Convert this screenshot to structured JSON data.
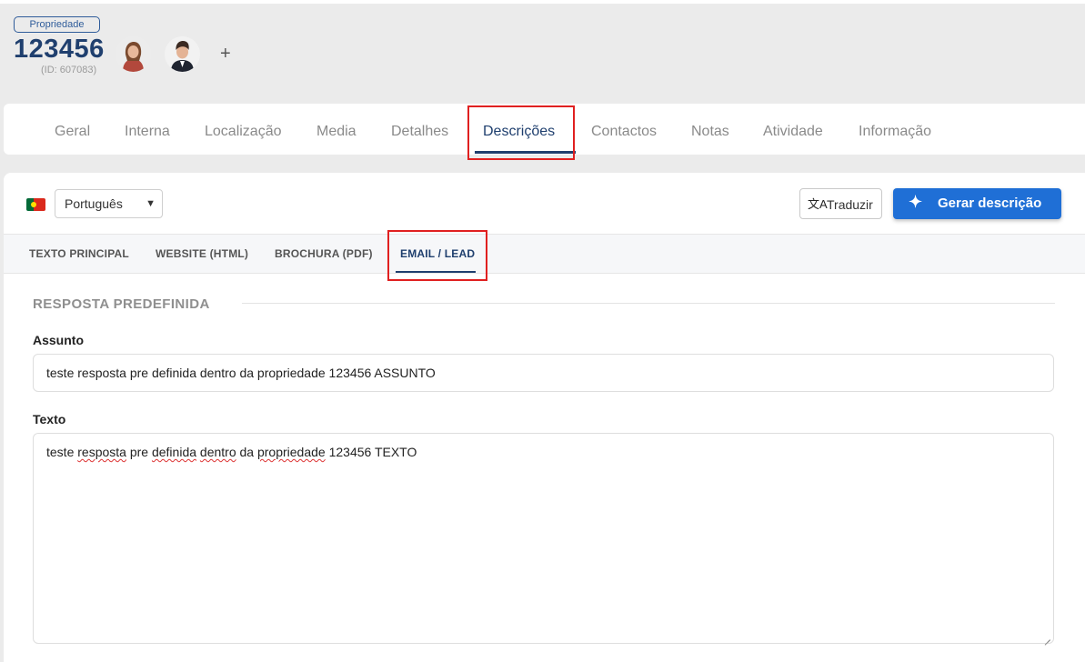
{
  "header": {
    "badge": "Propriedade",
    "reference": "123456",
    "id_text": "(ID: 607083)",
    "add_symbol": "+"
  },
  "nav": {
    "tabs": [
      {
        "label": "Geral"
      },
      {
        "label": "Interna"
      },
      {
        "label": "Localização"
      },
      {
        "label": "Media"
      },
      {
        "label": "Detalhes"
      },
      {
        "label": "Descrições",
        "active": true
      },
      {
        "label": "Contactos"
      },
      {
        "label": "Notas"
      },
      {
        "label": "Atividade"
      },
      {
        "label": "Informação"
      }
    ]
  },
  "toolbar": {
    "language": "Português",
    "translate_label": "Traduzir",
    "generate_label": "Gerar descrição"
  },
  "subtabs": [
    {
      "label": "TEXTO PRINCIPAL"
    },
    {
      "label": "WEBSITE (HTML)"
    },
    {
      "label": "BROCHURA (PDF)"
    },
    {
      "label": "EMAIL / LEAD",
      "active": true
    }
  ],
  "form": {
    "section_title": "RESPOSTA PREDEFINIDA",
    "subject_label": "Assunto",
    "subject_value": "teste resposta pre definida dentro da propriedade 123456 ASSUNTO",
    "text_label": "Texto",
    "text_words": [
      "teste ",
      "resposta",
      " pre ",
      "definida",
      " ",
      "dentro",
      " da ",
      "propriedade",
      " 123456 TEXTO"
    ]
  },
  "colors": {
    "accent": "#1f3f6e",
    "primary_button": "#1f6fd6",
    "highlight_box": "#e02020"
  }
}
